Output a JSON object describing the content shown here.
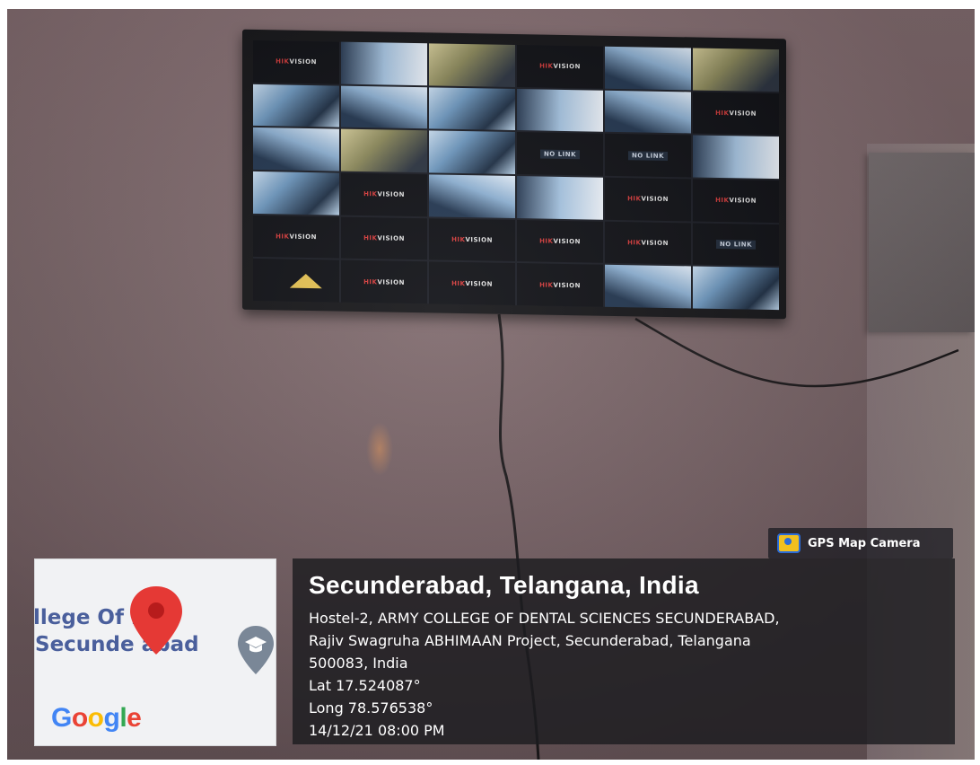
{
  "monitor": {
    "grid": [
      {
        "kind": "brand"
      },
      {
        "kind": "cam",
        "variant": "v3"
      },
      {
        "kind": "cam",
        "variant": "warm"
      },
      {
        "kind": "brand"
      },
      {
        "kind": "cam",
        "variant": "v2"
      },
      {
        "kind": "cam",
        "variant": "warm"
      },
      {
        "kind": "cam"
      },
      {
        "kind": "cam",
        "variant": "v2"
      },
      {
        "kind": "cam"
      },
      {
        "kind": "cam",
        "variant": "v3"
      },
      {
        "kind": "cam",
        "variant": "v2"
      },
      {
        "kind": "brand"
      },
      {
        "kind": "cam",
        "variant": "v2"
      },
      {
        "kind": "cam",
        "variant": "warm"
      },
      {
        "kind": "cam"
      },
      {
        "kind": "nolink"
      },
      {
        "kind": "nolink"
      },
      {
        "kind": "cam",
        "variant": "v3"
      },
      {
        "kind": "cam"
      },
      {
        "kind": "brand"
      },
      {
        "kind": "cam",
        "variant": "v2"
      },
      {
        "kind": "cam",
        "variant": "v3"
      },
      {
        "kind": "brand"
      },
      {
        "kind": "brand"
      },
      {
        "kind": "brand"
      },
      {
        "kind": "brand"
      },
      {
        "kind": "brand"
      },
      {
        "kind": "brand"
      },
      {
        "kind": "brand"
      },
      {
        "kind": "nolink"
      },
      {
        "kind": "tent"
      },
      {
        "kind": "brand"
      },
      {
        "kind": "brand"
      },
      {
        "kind": "brand"
      },
      {
        "kind": "cam",
        "variant": "v2"
      },
      {
        "kind": "cam"
      }
    ],
    "brand_red": "HIK",
    "brand_white": "VISION",
    "no_link_label": "NO LINK"
  },
  "gps_badge": {
    "icon": "gps-map-camera-app-icon",
    "label": "GPS Map Camera"
  },
  "map_thumbnail": {
    "line1": "llege Of ntal",
    "line2": "Secunde abad",
    "pin_icon": "map-pin-icon",
    "place_icon": "education-place-icon",
    "logo": {
      "G": "#4285F4",
      "o1": "#EA4335",
      "o2": "#FBBC05",
      "g": "#4285F4",
      "l": "#34A853",
      "e": "#EA4335"
    }
  },
  "location": {
    "title": "Secunderabad, Telangana, India",
    "address_line1": "Hostel-2, ARMY COLLEGE OF DENTAL SCIENCES SECUNDERABAD,",
    "address_line2": "Rajiv Swagruha ABHIMAAN Project, Secunderabad, Telangana",
    "address_line3": "500083, India",
    "lat": "Lat 17.524087°",
    "long": "Long 78.576538°",
    "timestamp": "14/12/21 08:00 PM"
  }
}
